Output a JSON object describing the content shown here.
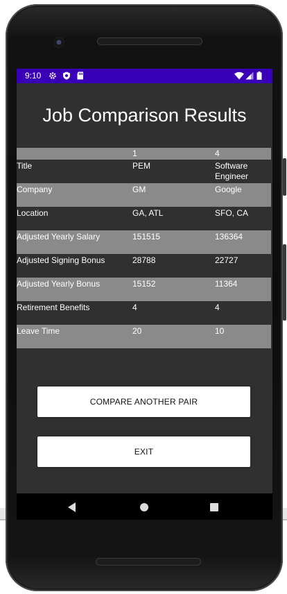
{
  "status_bar": {
    "time": "9:10",
    "icons": [
      "gear-icon",
      "shield-icon",
      "sd-card-icon",
      "wifi-icon",
      "signal-icon",
      "battery-icon"
    ],
    "color": "#3a00b8"
  },
  "screen": {
    "title": "Job Comparison Results"
  },
  "table": {
    "header": [
      "",
      "1",
      "4"
    ],
    "rows": [
      {
        "label": "Title",
        "job1": "PEM",
        "job2": "Software Engineer"
      },
      {
        "label": "Company",
        "job1": "GM",
        "job2": "Google"
      },
      {
        "label": "Location",
        "job1": "GA, ATL",
        "job2": "SFO, CA"
      },
      {
        "label": "Adjusted Yearly Salary",
        "job1": "151515",
        "job2": "136364"
      },
      {
        "label": "Adjusted Signing Bonus",
        "job1": "28788",
        "job2": "22727"
      },
      {
        "label": "Adjusted Yearly Bonus",
        "job1": "15152",
        "job2": "11364"
      },
      {
        "label": "Retirement Benefits",
        "job1": "4",
        "job2": "4"
      },
      {
        "label": "Leave Time",
        "job1": "20",
        "job2": "10"
      }
    ]
  },
  "buttons": {
    "compare_label": "COMPARE ANOTHER PAIR",
    "exit_label": "EXIT"
  },
  "nav": {
    "icons": [
      "back-icon",
      "home-icon",
      "recents-icon"
    ]
  },
  "colors": {
    "background": "#303030",
    "row_shade": "#8a8a8a",
    "button": "#ffffff"
  }
}
